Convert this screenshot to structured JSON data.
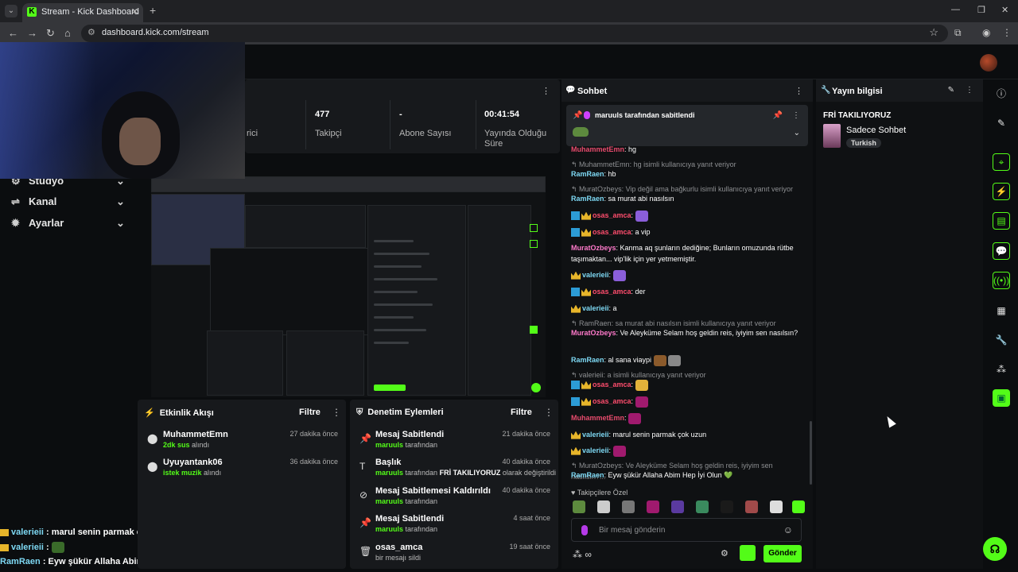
{
  "browser": {
    "tab_title": "Stream - Kick Dashboard",
    "tab_favicon": "K",
    "url": "dashboard.kick.com/stream"
  },
  "leftnav": {
    "items": [
      {
        "label": "Stüdyo",
        "icon": "studio-icon"
      },
      {
        "label": "Kanal",
        "icon": "channel-icon"
      },
      {
        "label": "Ayarlar",
        "icon": "gear-icon"
      }
    ]
  },
  "stats": {
    "partial_label": "rici",
    "followers_value": "477",
    "followers_label": "Takipçi",
    "subs_value": "-",
    "subs_label": "Abone Sayısı",
    "uptime_value": "00:41:54",
    "uptime_label_1": "Yayında Olduğu",
    "uptime_label_2": "Süre"
  },
  "overlay_chat": [
    {
      "user": "valerieii",
      "text": ": marul senin parmak çok uzun"
    },
    {
      "user": "valerieii",
      "text": ":"
    },
    {
      "user": "RamRaen",
      "text": ": Eyw şükür Allaha Abim Hep İyi Olun 💚"
    }
  ],
  "activity": {
    "title": "Etkinlik Akışı",
    "filter": "Filtre",
    "events": [
      {
        "user": "MuhammetEmn",
        "highlight": "2dk sus",
        "suffix": "alındı",
        "time": "27 dakika önce"
      },
      {
        "user": "Uyuyantank06",
        "highlight": "istek muzik",
        "suffix": "alındı",
        "time": "36 dakika önce"
      }
    ]
  },
  "moderation": {
    "title": "Denetim Eylemleri",
    "filter": "Filtre",
    "events": [
      {
        "title": "Mesaj Sabitlendi",
        "actor": "maruuls",
        "detail": "tarafından",
        "extra": "",
        "extra2": "",
        "time": "21 dakika önce"
      },
      {
        "title": "Başlık",
        "actor": "maruuls",
        "detail": "tarafından",
        "extra": "FRİ TAKILIYORUZ",
        "extra2": "olarak değiştirildi",
        "time": "40 dakika önce"
      },
      {
        "title": "Mesaj Sabitlemesi Kaldırıldı",
        "actor": "maruuls",
        "detail": "tarafından",
        "extra": "",
        "extra2": "",
        "time": "40 dakika önce"
      },
      {
        "title": "Mesaj Sabitlendi",
        "actor": "maruuls",
        "detail": "tarafından",
        "extra": "",
        "extra2": "",
        "time": "4 saat önce"
      },
      {
        "title": "osas_amca",
        "actor": "",
        "detail": "bir mesajı sildi",
        "extra": "",
        "extra2": "",
        "time": "19 saat önce"
      }
    ]
  },
  "chat": {
    "title": "Sohbet",
    "pinned_by": "maruuls",
    "pinned_text": "tarafından sabitlendi",
    "messages": [
      {
        "user": "MuhammetEmn",
        "text": ": hg"
      },
      {
        "reply": "MuhammetEmn: hg isimli kullanıcıya yanıt veriyor"
      },
      {
        "user": "RamRaen",
        "text": ": hb"
      },
      {
        "reply": "MuratOzbeys: Vip değil ama bağkurlu isimli kullanıcıya yanıt veriyor"
      },
      {
        "user": "RamRaen",
        "text": ": sa murat abi nasılsın"
      },
      {
        "user": "osas_amca",
        "text": ":"
      },
      {
        "user": "osas_amca",
        "text": ": a vip"
      },
      {
        "user": "MuratOzbeys",
        "text": ": Kanma aq şunların dediğine; Bunların omuzunda rütbe taşımaktan... vip'lik için yer yetmemiştir."
      },
      {
        "user": "valerieii",
        "text": ":"
      },
      {
        "user": "osas_amca",
        "text": ": der"
      },
      {
        "user": "valerieii",
        "text": ": a"
      },
      {
        "reply": "RamRaen: sa murat abi nasılsın isimli kullanıcıya yanıt veriyor"
      },
      {
        "user": "MuratOzbeys",
        "text": ": Ve Aleyküme Selam hoş geldin reis, iyiyim sen nasılsın?"
      },
      {
        "user": "RamRaen",
        "text": ": al sana viaypi"
      },
      {
        "reply": "valerieii: a isimli kullanıcıya yanıt veriyor"
      },
      {
        "user": "osas_amca",
        "text": ":"
      },
      {
        "user": "osas_amca",
        "text": ":"
      },
      {
        "user": "MuhammetEmn",
        "text": ":"
      },
      {
        "user": "valerieii",
        "text": ": marul senin parmak çok uzun"
      },
      {
        "user": "valerieii",
        "text": ":"
      },
      {
        "reply": "MuratOzbeys: Ve Aleyküme Selam hoş geldin reis, iyiyim sen nasılsın?..."
      },
      {
        "user": "RamRaen",
        "text": ": Eyw şükür Allaha Abim Hep İyi Olun 💚"
      }
    ],
    "emote_bar_title": "Takipçilere Özel",
    "input_placeholder": "Bir mesaj gönderin",
    "send_label": "Gönder"
  },
  "info": {
    "title": "Yayın bilgisi",
    "stream_title": "FRİ TAKILIYORUZ",
    "category": "Sadece Sohbet",
    "language": "Turkish"
  },
  "colors": {
    "accent": "#53fc18",
    "panel": "#17191c",
    "bg": "#0b0d0f"
  }
}
